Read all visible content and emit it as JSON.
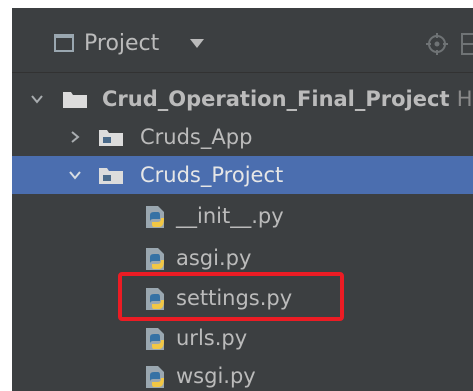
{
  "toolbar": {
    "title": "Project"
  },
  "tree": {
    "root": {
      "label": "Crud_Operation_Final_Project",
      "path_hint": "H:\\"
    },
    "items": [
      {
        "label": "Cruds_App"
      },
      {
        "label": "Cruds_Project"
      }
    ],
    "files": [
      {
        "label": "__init__.py"
      },
      {
        "label": "asgi.py"
      },
      {
        "label": "settings.py"
      },
      {
        "label": "urls.py"
      },
      {
        "label": "wsgi.py"
      }
    ]
  },
  "colors": {
    "panel_bg": "#3c3f41",
    "selection": "#4b6eaf",
    "text": "#bbbbbb",
    "highlight": "#ec1c24",
    "folder": "#dcdcdc",
    "python_blue": "#3572a5",
    "python_yellow": "#f2c744"
  },
  "icons": {
    "project": "project-window-icon",
    "dropdown": "triangle-down-icon",
    "target": "crosshair-icon",
    "expanded": "chevron-down-icon",
    "collapsed": "chevron-right-icon",
    "folder": "folder-icon",
    "python_file": "python-file-icon"
  }
}
